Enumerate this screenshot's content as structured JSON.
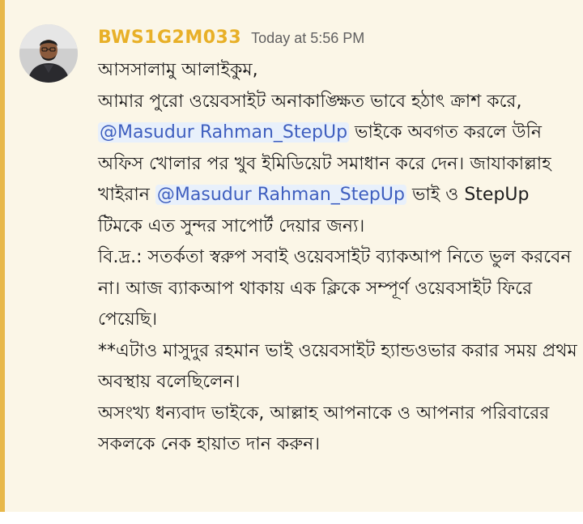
{
  "message": {
    "author": "BWS1G2M033",
    "timestamp": "Today at 5:56 PM",
    "lines": [
      {
        "parts": [
          {
            "text": "আসসালামু আলাইকুম,"
          }
        ]
      },
      {
        "parts": [
          {
            "text": "আমার পুরো ওয়েবসাইট অনাকাঙ্ক্ষিত ভাবে হঠাৎ ক্রাশ করে, "
          },
          {
            "mention": "@Masudur Rahman_StepUp"
          },
          {
            "text": " ভাইকে অবগত করলে উনি অফিস খোলার পর খুব ইমিডিয়েট সমাধান করে দেন। জাযাকাল্লাহ খাইরান "
          },
          {
            "mention": "@Masudur Rahman_StepUp"
          },
          {
            "text": " ভাই ও StepUp টিমকে এত সুন্দর সাপোর্ট দেয়ার জন্য।"
          }
        ]
      },
      {
        "parts": [
          {
            "text": "বি.দ্র.: সতর্কতা স্বরুপ সবাই ওয়েবসাইট ব্যাকআপ নিতে ভুল করবেন না। আজ ব্যাকআপ থাকায় এক ক্লিকে সম্পূর্ণ ওয়েবসাইট ফিরে পেয়েছি।"
          }
        ]
      },
      {
        "parts": [
          {
            "text": "**এটাও মাসুদুর রহমান ভাই ওয়েবসাইট হ্যান্ডওভার করার সময় প্রথম অবস্থায় বলেছিলেন।"
          }
        ]
      },
      {
        "parts": [
          {
            "text": "অসংখ্য ধন্যবাদ ভাইকে, আল্লাহ আপনাকে ও আপনার পরিবারের সকলকে নেক হায়াত দান করুন।"
          }
        ]
      }
    ]
  },
  "colors": {
    "background": "#fbf6e7",
    "highlight_bar": "#e8b84a",
    "author": "#e8b028",
    "timestamp": "#616061",
    "text": "#1d1c1d",
    "mention_text": "#3f5fbf",
    "mention_bg": "#e8f0fb"
  },
  "icons": {
    "avatar": "user-avatar-photo"
  }
}
